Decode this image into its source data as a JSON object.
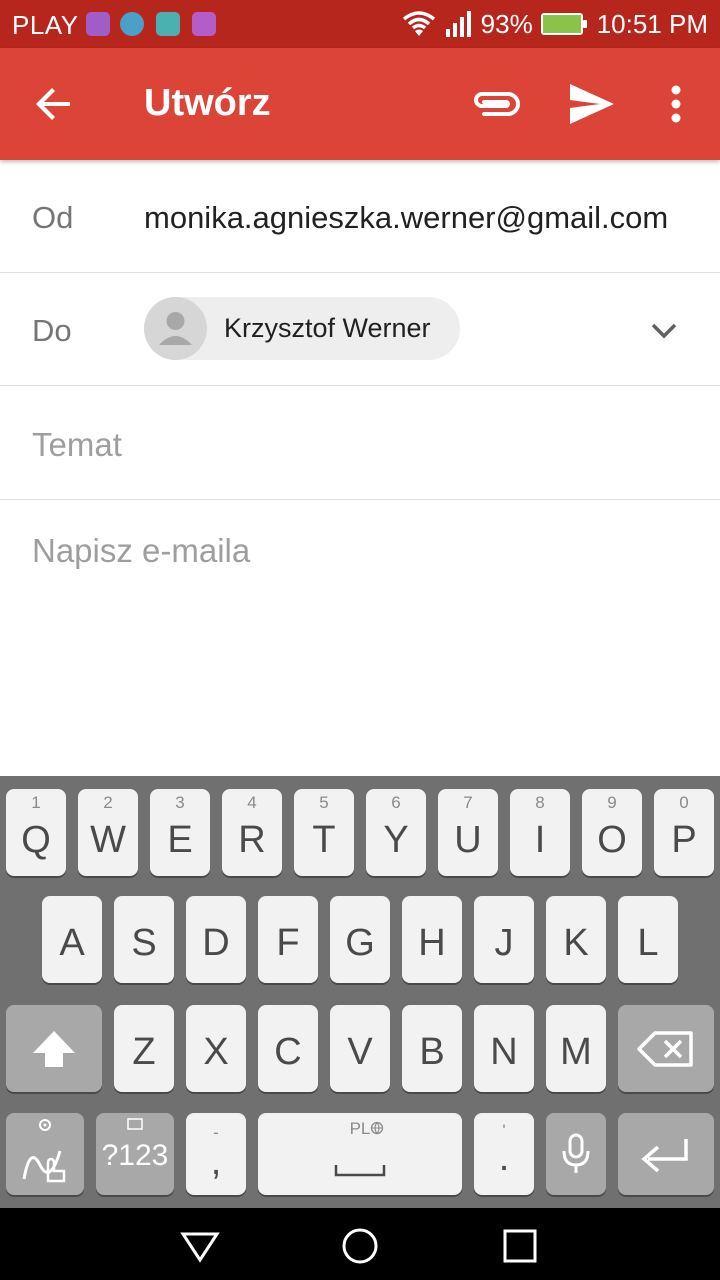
{
  "status_bar": {
    "carrier": "PLAY",
    "battery": "93%",
    "time": "10:51 PM"
  },
  "app_bar": {
    "title": "Utwórz",
    "color": "#db4437"
  },
  "compose": {
    "from_label": "Od",
    "from_value": "monika.agnieszka.werner@gmail.com",
    "to_label": "Do",
    "to_chip": "Krzysztof Werner",
    "subject_placeholder": "Temat",
    "body_placeholder": "Napisz e-maila"
  },
  "keyboard": {
    "row1": [
      {
        "num": "1",
        "key": "Q"
      },
      {
        "num": "2",
        "key": "W"
      },
      {
        "num": "3",
        "key": "E"
      },
      {
        "num": "4",
        "key": "R"
      },
      {
        "num": "5",
        "key": "T"
      },
      {
        "num": "6",
        "key": "Y"
      },
      {
        "num": "7",
        "key": "U"
      },
      {
        "num": "8",
        "key": "I"
      },
      {
        "num": "9",
        "key": "O"
      },
      {
        "num": "0",
        "key": "P"
      }
    ],
    "row2": [
      "A",
      "S",
      "D",
      "F",
      "G",
      "H",
      "J",
      "K",
      "L"
    ],
    "row3": [
      "Z",
      "X",
      "C",
      "V",
      "B",
      "N",
      "M"
    ],
    "symbols_label": "?123",
    "comma_label": ",",
    "comma_alt": "-",
    "space_lang": "PL",
    "period_label": ".",
    "period_alt": "'"
  },
  "icons": {
    "back": "arrow-back-icon",
    "attach": "paperclip-icon",
    "send": "send-icon",
    "more": "more-vert-icon",
    "wifi": "wifi-icon",
    "signal": "signal-icon",
    "battery": "battery-charging-icon"
  }
}
